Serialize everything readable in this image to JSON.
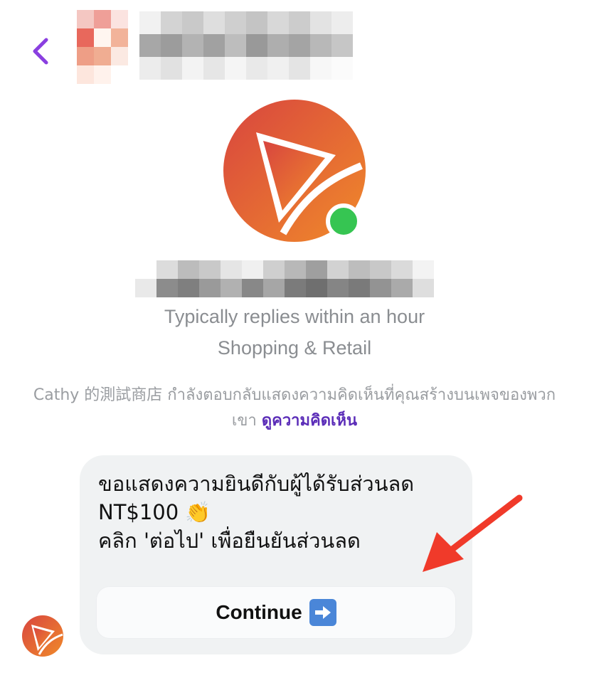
{
  "header": {
    "back_icon": "chevron-left-icon",
    "accent_color": "#8a3fe0"
  },
  "profile": {
    "online_status": "online",
    "reply_time": "Typically replies within an hour",
    "category": "Shopping & Retail"
  },
  "notice": {
    "text": "Cathy 的測試商店 กำลังตอบกลับแสดงความคิดเห็นที่คุณสร้างบนเพจของพวกเขา",
    "link_label": "ดูความคิดเห็น",
    "link_color": "#5b2db8"
  },
  "message": {
    "text": "ขอแสดงความยินดีกับผู้ได้รับส่วนลด\nNT$100 👏\nคลิก 'ต่อไป' เพื่อยืนยันส่วนลด",
    "button_label": "Continue",
    "button_icon": "right-arrow-emoji-icon"
  },
  "annotation": {
    "arrow_color": "#f03a2a"
  },
  "brand": {
    "gradient_start": "#d94a3e",
    "gradient_end": "#ef8a2a"
  }
}
